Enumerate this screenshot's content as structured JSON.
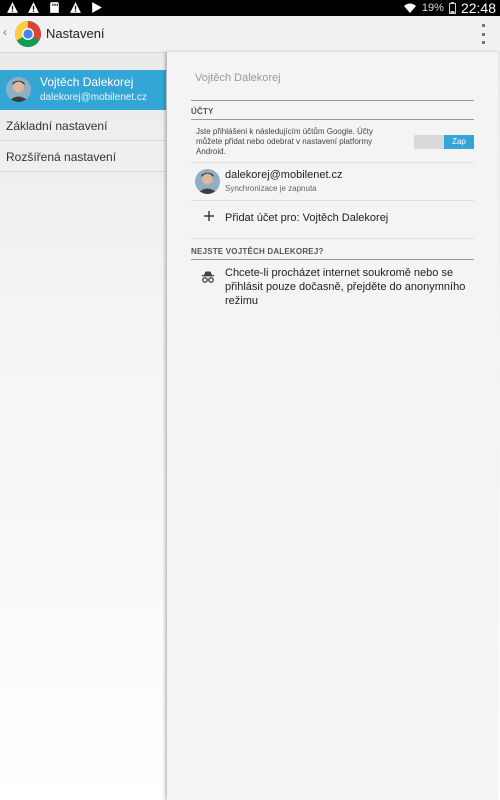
{
  "status_bar": {
    "icons": [
      "warning-icon",
      "warning-icon",
      "sd-card-icon",
      "warning-icon",
      "play-icon",
      "wifi-icon",
      "battery-icon"
    ],
    "battery": "19%",
    "time": "22:48"
  },
  "action_bar": {
    "title": "Nastavení",
    "logo": "chrome-logo-icon",
    "menu": "overflow-menu-icon"
  },
  "sidebar": {
    "account": {
      "name": "Vojtěch Dalekorej",
      "email": "dalekorej@mobilenet.cz"
    },
    "items": [
      {
        "label": "Základní nastavení"
      },
      {
        "label": "Rozšířená nastavení"
      }
    ]
  },
  "detail": {
    "title": "Vojtěch Dalekorej",
    "accounts_header": "ÚČTY",
    "info_text": "Jste přihlášeni k následujícím účtům Google. Účty můžete přidat nebo odebrat v nastavení platformy Android.",
    "toggle_label": "Zap",
    "account_email": "dalekorej@mobilenet.cz",
    "account_sync": "Synchronizace je zapnuta",
    "add_account": "Přidat účet pro: Vojtěch Dalekorej",
    "not_you_header": "NEJSTE VOJTĚCH DALEKOREJ?",
    "incognito_text": "Chcete-li procházet internet soukromě nebo se přihlásit pouze dočasně, přejděte do anonymního režimu"
  },
  "colors": {
    "accent": "#33a6d6",
    "status_bar": "#000000",
    "action_bar": "#f1f1f1"
  }
}
